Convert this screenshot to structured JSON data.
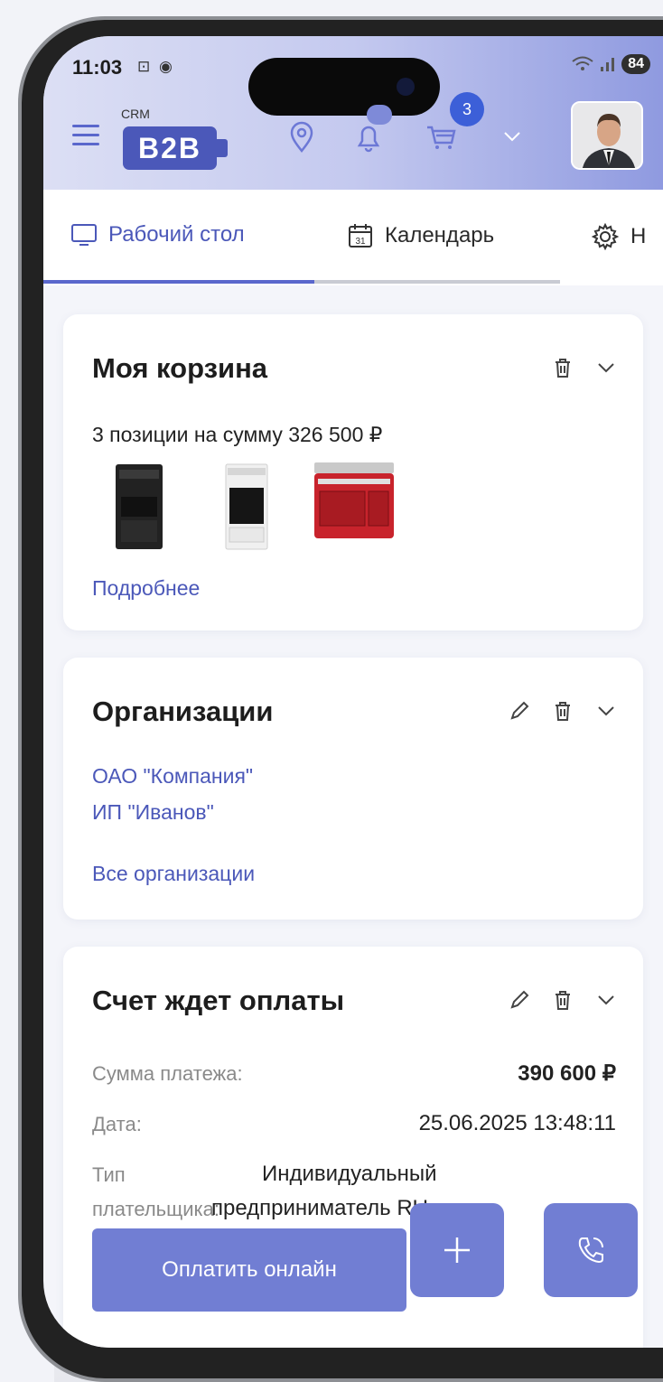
{
  "status_bar": {
    "time": "11:03",
    "battery": "84"
  },
  "header": {
    "logo_small": "CRM",
    "logo_main": "B2B",
    "cart_count": "3"
  },
  "tabs": [
    {
      "label": "Рабочий стол",
      "icon": "monitor-icon"
    },
    {
      "label": "Календарь",
      "icon": "calendar-icon",
      "icon_text": "31"
    },
    {
      "label": "Н",
      "icon": "gear-icon"
    }
  ],
  "cart_card": {
    "title": "Моя корзина",
    "summary": "3 позиции на сумму 326 500 ₽",
    "products": [
      "black-stove",
      "white-stove",
      "red-range-cooker"
    ],
    "link": "Подробнее"
  },
  "org_card": {
    "title": "Организации",
    "orgs": [
      "ОАО \"Компания\"",
      "ИП \"Иванов\""
    ],
    "link": "Все организации"
  },
  "invoice_card": {
    "title": "Счет ждет оплаты",
    "amount_label": "Сумма платежа:",
    "amount_value": "390 600 ₽",
    "date_label": "Дата:",
    "date_value": "25.06.2025 13:48:11",
    "payer_label_1": "Тип",
    "payer_label_2": "плательщика:",
    "payer_value_1": "Индивидуальный",
    "payer_value_2": "предприниматель RU",
    "pay_button": "Оплатить онлайн"
  },
  "colors": {
    "accent": "#4b58b9",
    "button": "#717ed3",
    "badge": "#3c5fd8"
  }
}
